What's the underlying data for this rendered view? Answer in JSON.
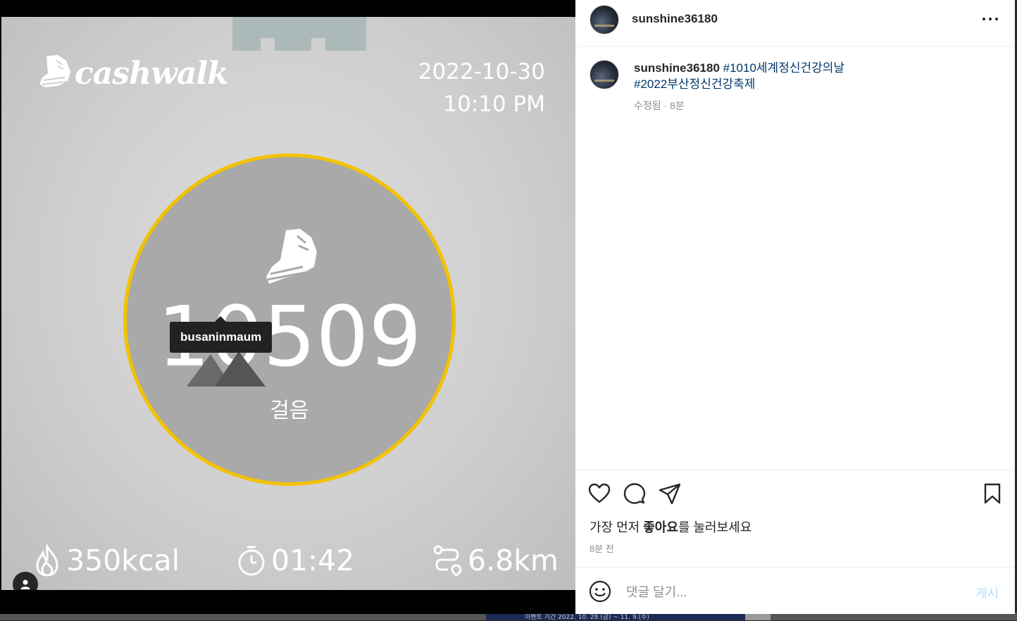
{
  "post_image": {
    "app_name": "cashwalk",
    "date": "2022-10-30",
    "time": "10:10 PM",
    "steps": "10509",
    "steps_label": "걸음",
    "calories": "350kcal",
    "duration": "01:42",
    "distance": "6.8km",
    "tagged_user": "busaninmaum",
    "ring_color": "#f2c200"
  },
  "header": {
    "username": "sunshine36180"
  },
  "caption": {
    "username": "sunshine36180",
    "hashtag_1": "#1010세계정신건강의날",
    "hashtag_2": "#2022부산정신건강축제",
    "edited": "수정됨 · 8분"
  },
  "actions": {
    "like_prompt_pre": "가장 먼저 ",
    "like_prompt_bold": "좋아요",
    "like_prompt_post": "를 눌러보세요",
    "time_ago": "8분 전"
  },
  "comment": {
    "placeholder": "댓글 달기...",
    "post_label": "게시"
  },
  "backdrop": {
    "event_text": "이벤트 기간 2022. 10. 28.(금) ~ 11. 9.(수)"
  },
  "colors": {
    "hashtag": "#00376b",
    "post_disabled": "#b2dffc"
  }
}
